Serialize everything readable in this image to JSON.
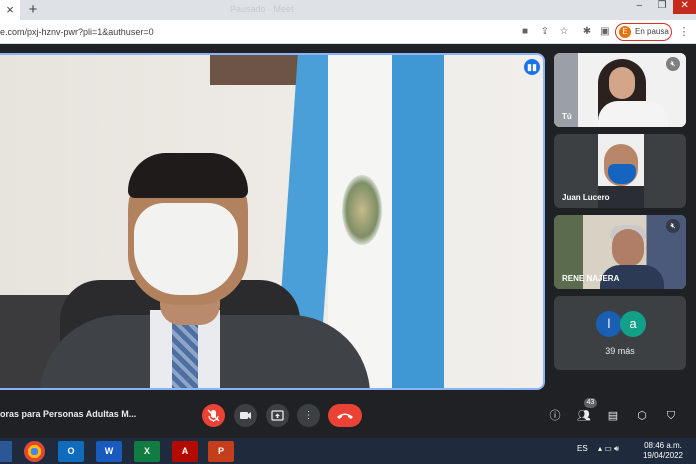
{
  "browser": {
    "tab_close": "×",
    "new_tab": "+",
    "ghost_tab_title": "Pausado · Meet",
    "url": "e.com/pxj-hznv-pwr?pli=1&authuser=0",
    "pause_avatar_initial": "E",
    "pause_label": "En pausa",
    "window_controls": [
      "–",
      "❐",
      "✕"
    ]
  },
  "meeting": {
    "title": "oras para Personas Adultas M...",
    "participants": [
      {
        "name": "Tú"
      },
      {
        "name": "Juan Lucero"
      },
      {
        "name": "RENE NAJERA"
      }
    ],
    "others": {
      "initials": [
        "l",
        "a"
      ],
      "label": "39 más"
    },
    "people_count": "43"
  },
  "taskbar": {
    "apps": [
      "chrome",
      "outlook",
      "word",
      "excel",
      "acrobat",
      "powerpoint"
    ],
    "outlook_label": "O",
    "word_label": "W",
    "excel_label": "X",
    "pdf_label": "A",
    "ppt_label": "P",
    "language": "ES",
    "time": "08:46 a.m.",
    "date": "19/04/2022"
  },
  "colors": {
    "mic_off": "#ea4335",
    "end_call": "#ea4335",
    "active_speaker_border": "#8ab4f8",
    "pause_border": "#d93025"
  }
}
